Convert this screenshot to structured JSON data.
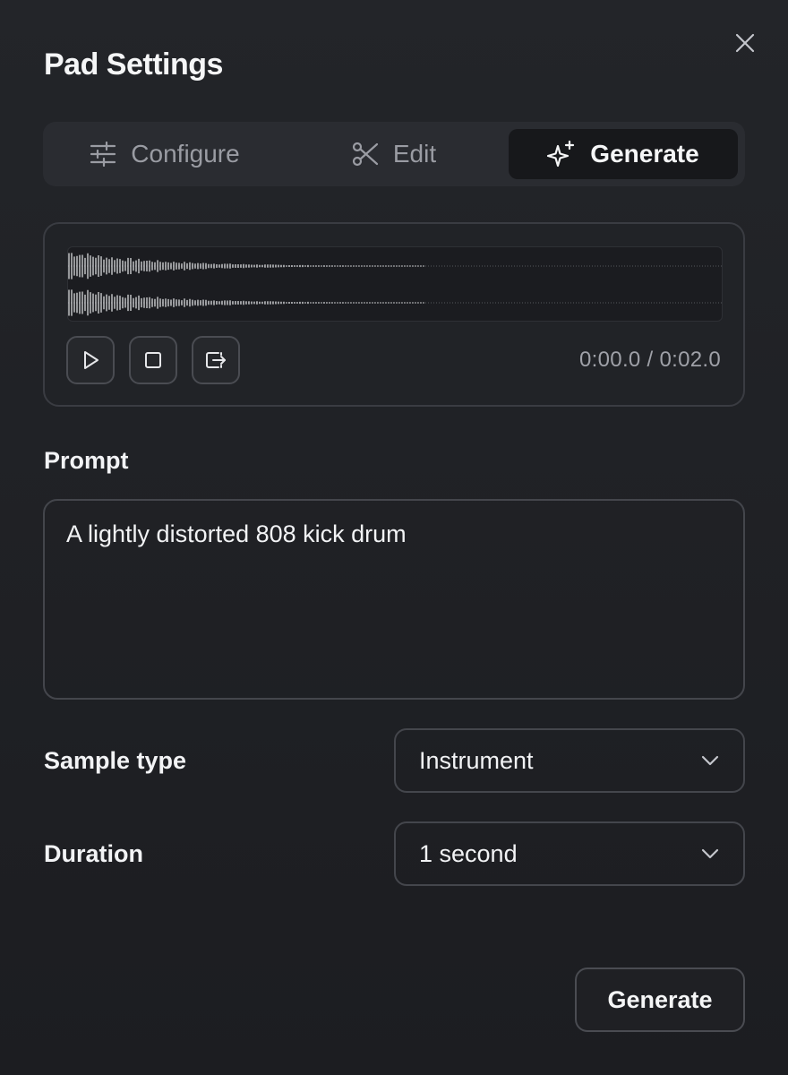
{
  "dialog": {
    "title": "Pad Settings"
  },
  "tabs": [
    {
      "label": "Configure",
      "icon": "sliders-icon",
      "active": false
    },
    {
      "label": "Edit",
      "icon": "scissors-icon",
      "active": false
    },
    {
      "label": "Generate",
      "icon": "sparkles-icon",
      "active": true
    }
  ],
  "player": {
    "time": "0:00.0 / 0:02.0"
  },
  "prompt": {
    "label": "Prompt",
    "value": "A lightly distorted 808 kick drum"
  },
  "sample_type": {
    "label": "Sample type",
    "value": "Instrument"
  },
  "duration": {
    "label": "Duration",
    "value": "1 second"
  },
  "actions": {
    "generate_label": "Generate"
  },
  "colors": {
    "background": "#1e2024",
    "text": "#f2f3f5",
    "muted": "#9a9ca3",
    "border": "#44464c"
  }
}
